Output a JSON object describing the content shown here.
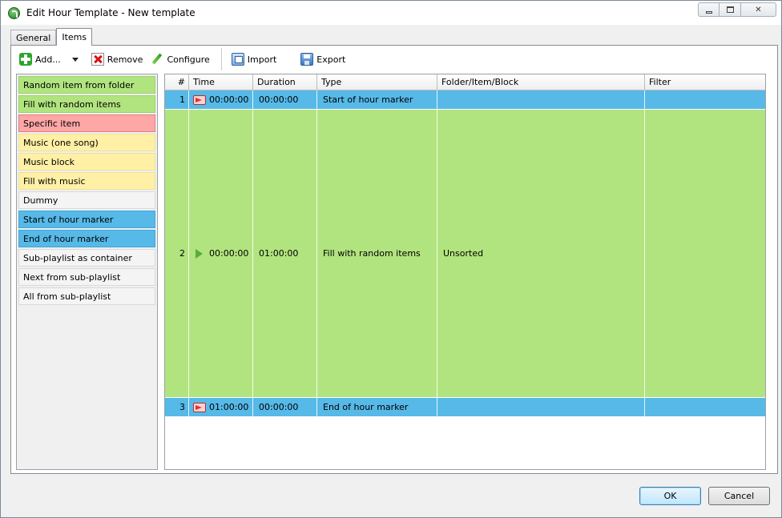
{
  "window": {
    "title": "Edit Hour Template - New template"
  },
  "tabs": [
    {
      "label": "General",
      "active": false
    },
    {
      "label": "Items",
      "active": true
    }
  ],
  "toolbar": {
    "add_label": "Add...",
    "remove_label": "Remove",
    "configure_label": "Configure",
    "import_label": "Import",
    "export_label": "Export"
  },
  "item_types": [
    {
      "label": "Random item from folder",
      "color": "#b1e47f"
    },
    {
      "label": "Fill with random items",
      "color": "#b1e47f"
    },
    {
      "label": "Specific item",
      "color": "#ffa6a6"
    },
    {
      "label": "Music (one song)",
      "color": "#fff0a6"
    },
    {
      "label": "Music block",
      "color": "#fff0a6"
    },
    {
      "label": "Fill with music",
      "color": "#fff0a6"
    },
    {
      "label": "Dummy",
      "color": "#f4f4f4"
    },
    {
      "label": "Start of hour marker",
      "color": "#56b9e8"
    },
    {
      "label": "End of hour marker",
      "color": "#56b9e8"
    },
    {
      "label": "Sub-playlist as container",
      "color": "#f4f4f4"
    },
    {
      "label": "Next from sub-playlist",
      "color": "#f4f4f4"
    },
    {
      "label": "All from sub-playlist",
      "color": "#f4f4f4"
    }
  ],
  "grid": {
    "columns": [
      "#",
      "Time",
      "Duration",
      "Type",
      "Folder/Item/Block",
      "Filter"
    ],
    "rows": [
      {
        "num": "1",
        "time_icon": "marker-icon",
        "time": "00:00:00",
        "duration": "00:00:00",
        "type": "Start of hour marker",
        "folder": "",
        "filter": "",
        "color": "#56b9e8"
      },
      {
        "num": "2",
        "time_icon": "play-icon",
        "time": "00:00:00",
        "duration": "01:00:00",
        "type": "Fill with random items",
        "folder": "Unsorted",
        "filter": "",
        "color": "#b1e47f"
      },
      {
        "num": "3",
        "time_icon": "marker-icon",
        "time": "01:00:00",
        "duration": "00:00:00",
        "type": "End of hour marker",
        "folder": "",
        "filter": "",
        "color": "#56b9e8"
      }
    ]
  },
  "buttons": {
    "ok_label": "OK",
    "cancel_label": "Cancel"
  }
}
